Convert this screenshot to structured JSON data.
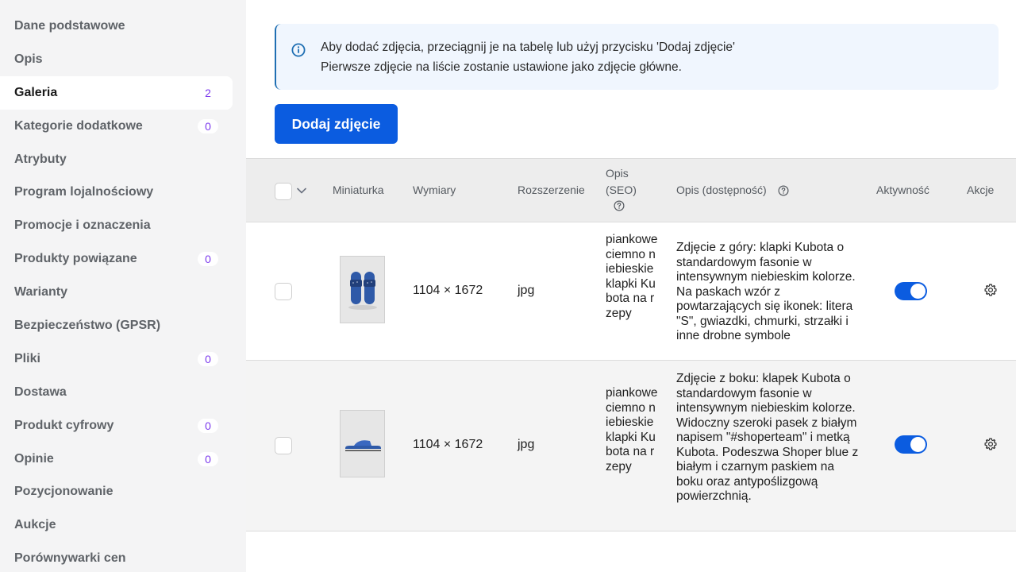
{
  "sidebar": {
    "items": [
      {
        "label": "Dane podstawowe",
        "count": ""
      },
      {
        "label": "Opis",
        "count": ""
      },
      {
        "label": "Galeria",
        "count": "2",
        "active": true
      },
      {
        "label": "Kategorie dodatkowe",
        "count": "0"
      },
      {
        "label": "Atrybuty",
        "count": ""
      },
      {
        "label": "Program lojalnościowy",
        "count": ""
      },
      {
        "label": "Promocje i oznaczenia",
        "count": ""
      },
      {
        "label": "Produkty powiązane",
        "count": "0"
      },
      {
        "label": "Warianty",
        "count": ""
      },
      {
        "label": "Bezpieczeństwo (GPSR)",
        "count": ""
      },
      {
        "label": "Pliki",
        "count": "0"
      },
      {
        "label": "Dostawa",
        "count": ""
      },
      {
        "label": "Produkt cyfrowy",
        "count": "0"
      },
      {
        "label": "Opinie",
        "count": "0"
      },
      {
        "label": "Pozycjonowanie",
        "count": ""
      },
      {
        "label": "Aukcje",
        "count": ""
      },
      {
        "label": "Porównywarki cen",
        "count": ""
      }
    ]
  },
  "info": {
    "line1": "Aby dodać zdjęcia, przeciągnij je na tabelę lub użyj przycisku 'Dodaj zdjęcie'",
    "line2": "Pierwsze zdjęcie na liście zostanie ustawione jako zdjęcie główne."
  },
  "toolbar": {
    "add_photo_label": "Dodaj zdjęcie"
  },
  "table": {
    "headers": {
      "thumbnail": "Miniaturka",
      "dimensions": "Wymiary",
      "extension": "Rozszerzenie",
      "seo_line1": "Opis",
      "seo_line2": "(SEO)",
      "alt": "Opis (dostępność)",
      "active": "Aktywność",
      "actions": "Akcje"
    },
    "rows": [
      {
        "dimensions": "1104 × 1672",
        "extension": "jpg",
        "seo": "piankowe ciemno niebieskie klapki Kubota na rzepy",
        "alt": "Zdjęcie z góry: klapki Kubota o standardowym fasonie w intensywnym niebieskim kolorze. Na paskach wzór z powtarzających się ikonek: litera \"S\", gwiazdki, chmurki, strzałki i inne drobne symbole",
        "active": true
      },
      {
        "dimensions": "1104 × 1672",
        "extension": "jpg",
        "seo": "piankowe ciemno niebieskie klapki Kubota na rzepy",
        "alt": "Zdjęcie z boku: klapek Kubota o standardowym fasonie w intensywnym niebieskim kolorze. Widoczny szeroki pasek z białym napisem \"#shoperteam\" i metką Kubota. Podeszwa Shoper blue z białym i czarnym paskiem na boku oraz antypoślizgową powierzchnią.",
        "active": true
      }
    ]
  },
  "colors": {
    "accent": "#0b5ce0",
    "badge": "#7c3aed",
    "info_bg": "#f0f6fe",
    "info_border": "#1f6fb3"
  },
  "icons": [
    "info-icon",
    "chevron-down-icon",
    "help-icon",
    "gear-icon"
  ]
}
